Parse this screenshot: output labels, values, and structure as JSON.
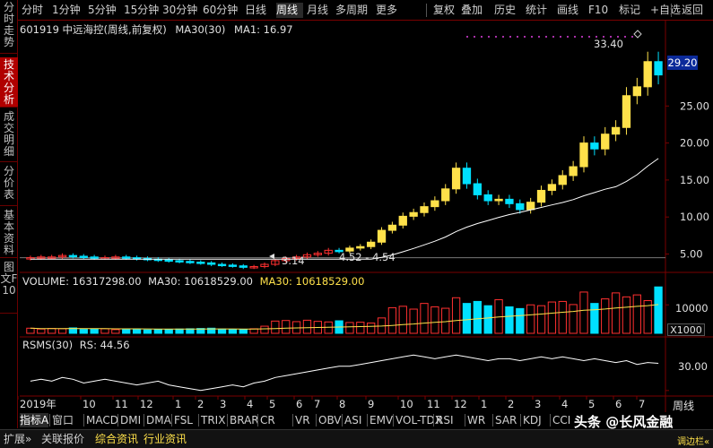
{
  "toolbar": {
    "items": [
      "分时",
      "1分钟",
      "5分钟",
      "15分钟",
      "30分钟",
      "60分钟",
      "日线",
      "周线",
      "月线",
      "多周期",
      "更多",
      "复权",
      "叠加",
      "历史",
      "统计",
      "画线",
      "F10",
      "标记",
      "+自选",
      "返回"
    ],
    "active": "周线"
  },
  "sidetabs": [
    "分时走势",
    "技术分析",
    "成交明细",
    "分价表",
    "基本资料",
    "图文F10"
  ],
  "sidetabs_active": "技术分析",
  "info": {
    "stock": "601919 中远海控(周线,前复权)",
    "ma30_label": "MA30(30)",
    "ma1_label": "MA1: 16.97"
  },
  "price_panel": {
    "y_labels": [
      "25.00",
      "20.00",
      "15.00",
      "10.00",
      "5.00"
    ],
    "current_price": "29.20",
    "max_label": "33.40",
    "min_label": "3.14",
    "range_label": "4.52 - 4.54"
  },
  "volume_panel": {
    "label_volume": "VOLUME: 16317298.00",
    "label_ma30": "MA30: 10618529.00",
    "label_ma30b": "MA30: 10618529.00",
    "y_label": "10000",
    "unit_label": "X1000"
  },
  "rsms_panel": {
    "label": "RSMS(30)",
    "rs": "RS: 44.56",
    "y_label": "30.00"
  },
  "x_axis": {
    "labels": [
      "2019年",
      "10",
      "11",
      "12",
      "1",
      "2",
      "3",
      "4",
      "5",
      "6",
      "7",
      "8",
      "9",
      "10",
      "11",
      "12",
      "1",
      "2",
      "3",
      "4",
      "5",
      "6",
      "7"
    ],
    "period": "周线"
  },
  "indicator_tabs": [
    "指标A",
    "窗口",
    "MACD",
    "DMI",
    "DMA",
    "FSL",
    "TRIX",
    "BRAR",
    "CR",
    "VR",
    "OBV",
    "ASI",
    "EMV",
    "VOL-TDX",
    "RSI",
    "WR",
    "SAR",
    "KDJ",
    "CCI"
  ],
  "statusbar": {
    "items": [
      "扩展»",
      "关联报价",
      "综合资讯",
      "行业资讯"
    ]
  },
  "watermark": {
    "text": "头条 @长风金融",
    "tag": "调边栏«"
  },
  "colors": {
    "up": "#ff3030",
    "down": "#00e0ff",
    "yellow": "#ffe14a",
    "grid": "#7a0000",
    "ma": "#ffffff"
  },
  "chart_data": {
    "type": "candlestick",
    "price_ylim": [
      3,
      34
    ],
    "closes": [
      4.5,
      4.6,
      4.6,
      4.8,
      4.7,
      4.6,
      4.5,
      4.5,
      4.6,
      4.5,
      4.4,
      4.3,
      4.2,
      4.1,
      4.0,
      3.9,
      3.8,
      3.6,
      3.5,
      3.4,
      3.2,
      3.3,
      3.6,
      4.1,
      4.4,
      4.6,
      4.9,
      5.1,
      5.5,
      5.4,
      5.8,
      6.0,
      6.6,
      8.2,
      8.9,
      10.1,
      10.6,
      11.4,
      12.2,
      13.8,
      16.6,
      14.5,
      13.0,
      12.2,
      12.4,
      11.8,
      11.0,
      12.0,
      13.6,
      14.4,
      15.6,
      16.8,
      20.0,
      19.2,
      21.2,
      22.1,
      26.4,
      27.6,
      31.0,
      29.2
    ],
    "volume_k": [
      1800,
      1500,
      1700,
      1600,
      1900,
      1400,
      1500,
      1600,
      1300,
      1400,
      1500,
      1200,
      1300,
      1400,
      1500,
      1600,
      1700,
      1800,
      1500,
      1400,
      1300,
      1600,
      2500,
      4300,
      4500,
      4100,
      4600,
      4200,
      4000,
      4400,
      3800,
      3900,
      3600,
      5400,
      9000,
      9500,
      8500,
      10500,
      9300,
      8800,
      12500,
      10500,
      11200,
      9700,
      11800,
      9300,
      8700,
      10000,
      9700,
      11000,
      11200,
      10100,
      14500,
      10500,
      12100,
      14200,
      12800,
      13500,
      11500,
      16300
    ],
    "volume_ylim": [
      0,
      17000
    ],
    "rs": [
      35,
      36,
      35,
      37,
      36,
      34,
      35,
      36,
      35,
      34,
      33,
      34,
      35,
      33,
      32,
      31,
      30,
      31,
      32,
      33,
      32,
      34,
      35,
      37,
      38,
      39,
      40,
      41,
      42,
      43,
      43,
      44,
      45,
      46,
      47,
      48,
      49,
      48,
      47,
      48,
      49,
      48,
      47,
      46,
      47,
      47,
      46,
      47,
      48,
      47,
      48,
      47,
      46,
      47,
      46,
      45,
      46,
      44,
      45,
      44.56
    ],
    "rs_ylim": [
      28,
      52
    ]
  }
}
